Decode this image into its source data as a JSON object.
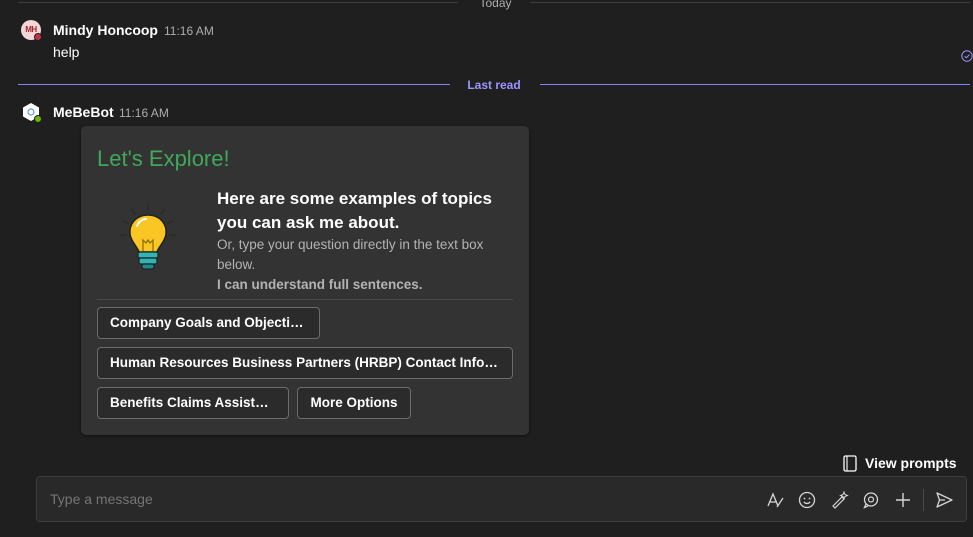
{
  "header": {
    "date_divider": "Today"
  },
  "messages": [
    {
      "sender": "Mindy Honcoop",
      "initials": "MH",
      "time": "11:16 AM",
      "text": "help"
    }
  ],
  "last_read_label": "Last read",
  "bot": {
    "sender": "MeBeBot",
    "time": "11:16 AM"
  },
  "card": {
    "title": "Let's Explore!",
    "heading": "Here are some examples of topics you can ask me about.",
    "subtext": "Or, type your question directly in the text box below.",
    "subtext2": "I can understand full sentences.",
    "actions": [
      "Company Goals and Objectives",
      "Human Resources Business Partners (HRBP) Contact Information",
      "Benefits Claims Assistance",
      "More Options"
    ]
  },
  "view_prompts_label": "View prompts",
  "compose": {
    "placeholder": "Type a message",
    "tools": [
      "format-icon",
      "emoji-icon",
      "copilot-icon",
      "loop-icon",
      "attach-icon",
      "send-icon"
    ]
  },
  "colors": {
    "accent": "#9b95ff",
    "title_green": "#3fa85a",
    "away_red": "#c4314b",
    "online_green": "#6bb700"
  }
}
